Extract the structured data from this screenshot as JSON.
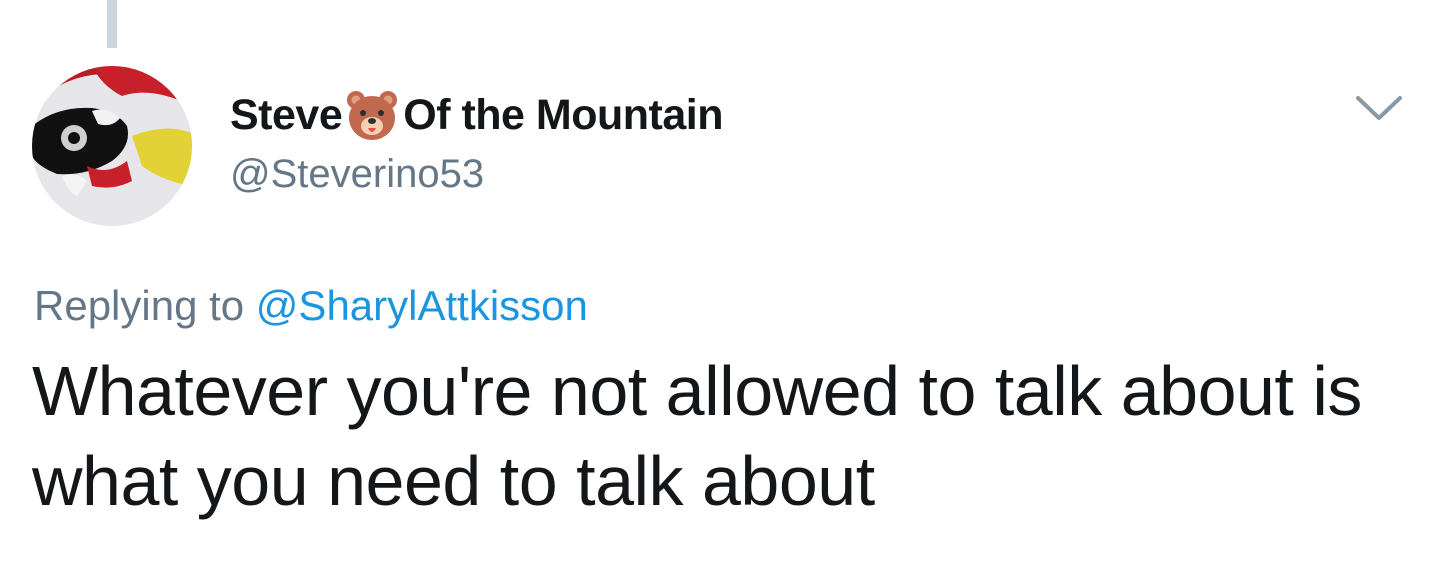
{
  "author": {
    "display_name_part1": "Steve",
    "display_name_emoji": "bear-face-icon",
    "display_name_part2": "Of the Mountain",
    "handle": "@Steverino53"
  },
  "reply": {
    "prefix": "Replying to",
    "mention": "@SharylAttkisson"
  },
  "tweet": {
    "text": "Whatever you're not allowed to talk about is what you need to talk about"
  },
  "colors": {
    "text": "#14171a",
    "secondary": "#657786",
    "link": "#1b95e0",
    "thread_line": "#ccd6dd"
  }
}
